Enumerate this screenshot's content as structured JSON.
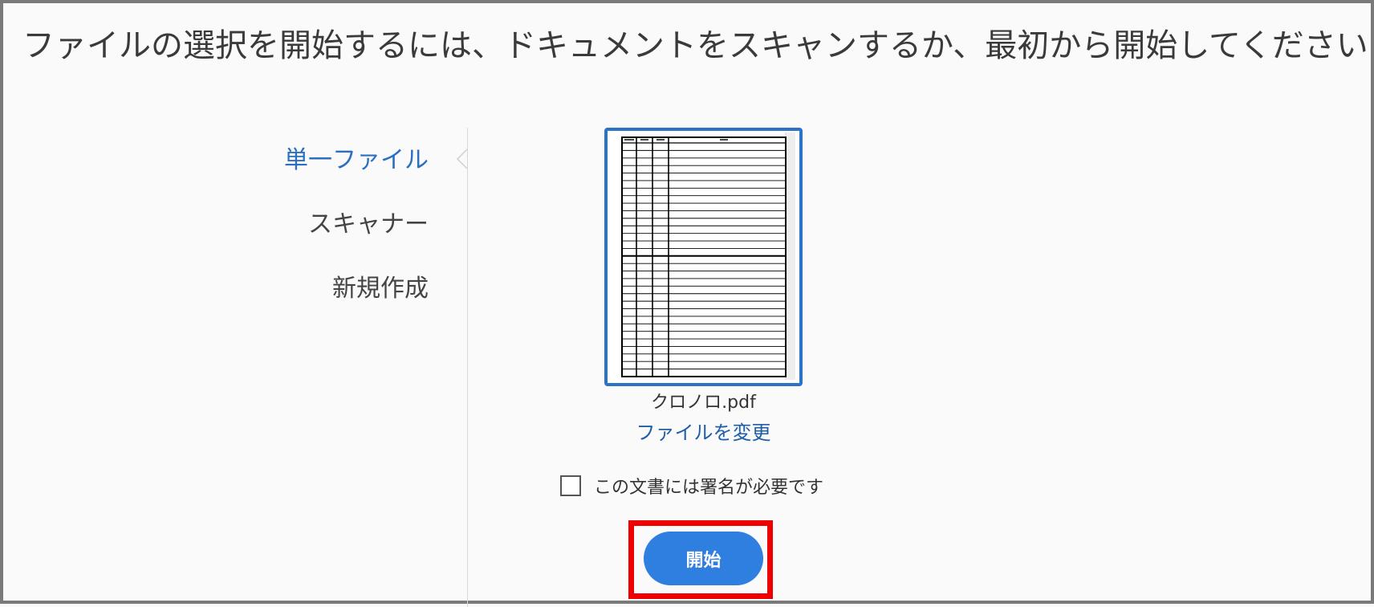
{
  "title": "ファイルの選択を開始するには、ドキュメントをスキャンするか、最初から開始してください",
  "nav": {
    "items": [
      {
        "label": "単一ファイル",
        "active": true
      },
      {
        "label": "スキャナー",
        "active": false
      },
      {
        "label": "新規作成",
        "active": false
      }
    ]
  },
  "file": {
    "name": "クロノロ.pdf",
    "change_label": "ファイルを変更"
  },
  "signature": {
    "label": "この文書には署名が必要です",
    "checked": false
  },
  "start_button": {
    "label": "開始"
  },
  "colors": {
    "accent": "#2a6fc0",
    "button": "#2f7fe0",
    "highlight": "#ee0000"
  }
}
